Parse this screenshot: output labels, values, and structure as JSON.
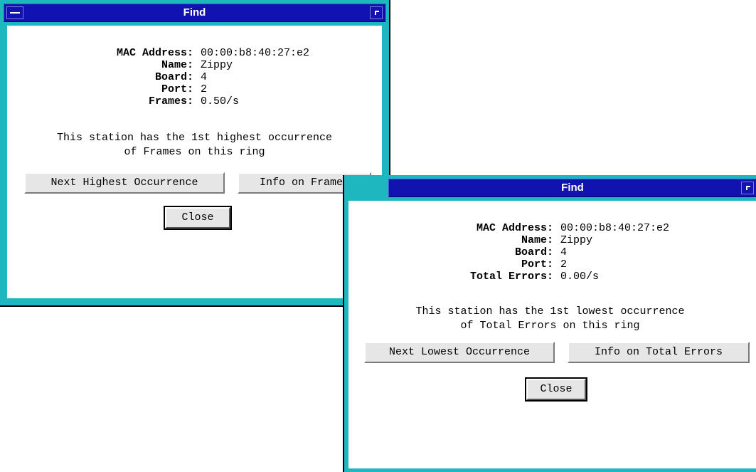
{
  "windows": [
    {
      "title": "Find",
      "fields": [
        {
          "label": "MAC Address:",
          "value": "00:00:b8:40:27:e2"
        },
        {
          "label": "Name:",
          "value": "Zippy"
        },
        {
          "label": "Board:",
          "value": "4"
        },
        {
          "label": "Port:",
          "value": "2"
        },
        {
          "label": "Frames:",
          "value": "0.50/s"
        }
      ],
      "message_line1": "This station has the 1st highest occurrence",
      "message_line2": "of Frames on this ring",
      "next_button": "Next Highest Occurrence",
      "info_button": "Info on Frames",
      "close_button": "Close"
    },
    {
      "title": "Find",
      "fields": [
        {
          "label": "MAC Address:",
          "value": "00:00:b8:40:27:e2"
        },
        {
          "label": "Name:",
          "value": "Zippy"
        },
        {
          "label": "Board:",
          "value": "4"
        },
        {
          "label": "Port:",
          "value": "2"
        },
        {
          "label": "Total Errors:",
          "value": "0.00/s"
        }
      ],
      "message_line1": "This station has the 1st lowest occurrence",
      "message_line2": "of Total Errors on this ring",
      "next_button": "Next Lowest Occurrence",
      "info_button": "Info on Total Errors",
      "close_button": "Close"
    }
  ],
  "colors": {
    "frame": "#1fb7bf",
    "titlebar": "#1212b0",
    "button_face": "#e6e6e6"
  }
}
